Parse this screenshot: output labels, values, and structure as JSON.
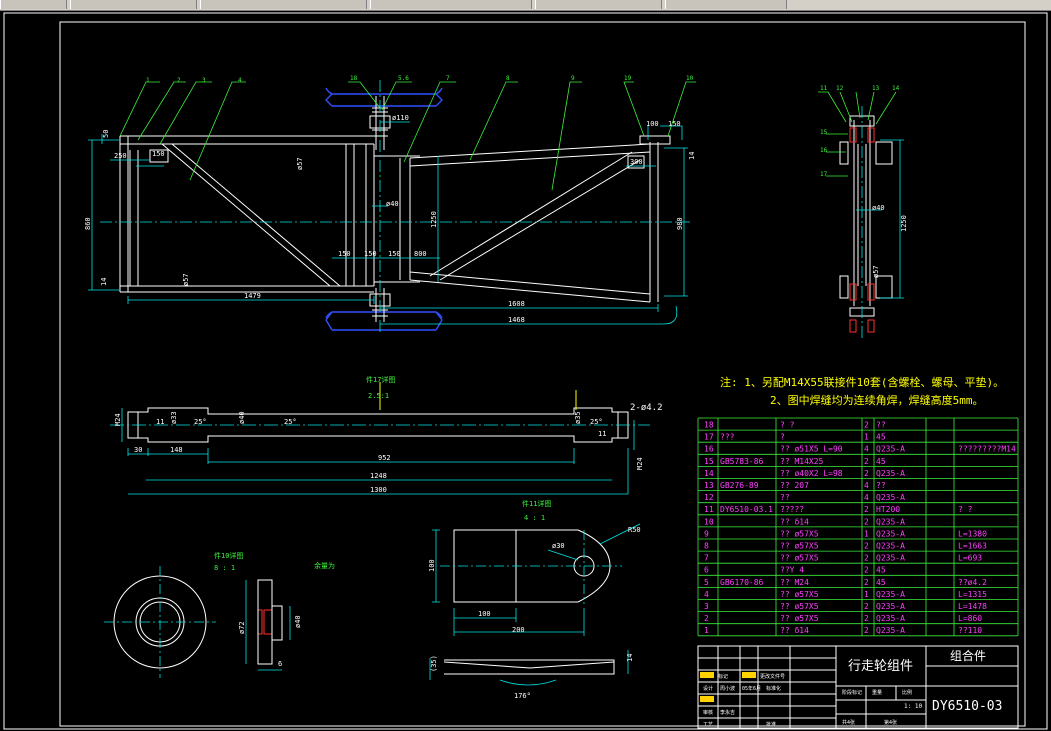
{
  "part_numbers_top": [
    "1",
    "2",
    "3",
    "4",
    "18",
    "5.6",
    "7",
    "8",
    "9",
    "19",
    "10"
  ],
  "part_numbers_side": [
    "11",
    "12",
    "13",
    "14",
    "15",
    "16",
    "17"
  ],
  "dims_top": {
    "d50": "50",
    "d250": "250",
    "d150": "150",
    "d57": "ø57",
    "d110": "ø110",
    "d100": "100",
    "d14": "14",
    "d860": "860",
    "d1250": "1250",
    "d40": "ø40",
    "d150b": "150",
    "d150c": "150",
    "d150d": "150",
    "d800": "800",
    "d980": "980",
    "d14b": "14",
    "d57b": "ø57",
    "d1479": "1479",
    "d1608": "1608",
    "d1468": "1468",
    "d300": "300"
  },
  "dims_side": {
    "d40": "ø40",
    "d1250": "1250",
    "d57": "ø57"
  },
  "detail17": {
    "title": "件17详图",
    "scale": "2.5:1",
    "dims": [
      "M24",
      "11",
      "ø33",
      "25°",
      "ø40",
      "25°",
      "ø35",
      "25°",
      "11",
      "M24",
      "30",
      "148",
      "952",
      "1248",
      "1300"
    ],
    "note": "2-ø4.2"
  },
  "detail11": {
    "title": "件11详图",
    "scale": "4 : 1",
    "dims": [
      "ø30",
      "R50",
      "100",
      "100",
      "200",
      "(35)",
      "176°",
      "14"
    ]
  },
  "detail10": {
    "title": "件10详图",
    "scale": "8 : 1",
    "side": "余量为",
    "dims": [
      "ø72",
      "ø40",
      "6"
    ]
  },
  "notes": [
    "注: 1、另配M14X55联接件10套(含螺栓、螺母、平垫)。",
    "2、图中焊缝均为连续角焊，焊缝高度5mm。"
  ],
  "bom": [
    {
      "no": "18",
      "code": "",
      "name": "? ?",
      "qty": "2",
      "mat": "??",
      "rem": ""
    },
    {
      "no": "17",
      "code": "???",
      "name": "?",
      "qty": "1",
      "mat": "45",
      "rem": ""
    },
    {
      "no": "16",
      "code": "",
      "name": "?? ø51X5    L=90",
      "qty": "4",
      "mat": "Q235-A",
      "rem": "?????????M14"
    },
    {
      "no": "15",
      "code": "GB5783-86",
      "name": "?? M14X25",
      "qty": "2",
      "mat": "45",
      "rem": ""
    },
    {
      "no": "14",
      "code": "",
      "name": "?? ø40X2    L=98",
      "qty": "2",
      "mat": "Q235-A",
      "rem": ""
    },
    {
      "no": "13",
      "code": "GB276-89",
      "name": "?? 207",
      "qty": "4",
      "mat": "??",
      "rem": ""
    },
    {
      "no": "12",
      "code": "",
      "name": "??",
      "qty": "4",
      "mat": "Q235-A",
      "rem": ""
    },
    {
      "no": "11",
      "code": "DY6510-03.1",
      "name": "?????",
      "qty": "2",
      "mat": "HT200",
      "rem": "? ?"
    },
    {
      "no": "10",
      "code": "",
      "name": "?? δ14",
      "qty": "2",
      "mat": "Q235-A",
      "rem": ""
    },
    {
      "no": "9",
      "code": "",
      "name": "?? ø57X5",
      "qty": "1",
      "mat": "Q235-A",
      "rem": "L=1380"
    },
    {
      "no": "8",
      "code": "",
      "name": "?? ø57X5",
      "qty": "2",
      "mat": "Q235-A",
      "rem": "L=1663"
    },
    {
      "no": "7",
      "code": "",
      "name": "?? ø57X5",
      "qty": "2",
      "mat": "Q235-A",
      "rem": "L=693"
    },
    {
      "no": "6",
      "code": "",
      "name": "??Y 4",
      "qty": "2",
      "mat": "45",
      "rem": ""
    },
    {
      "no": "5",
      "code": "GB6170-86",
      "name": "?? M24",
      "qty": "2",
      "mat": "45",
      "rem": "??ø4.2"
    },
    {
      "no": "4",
      "code": "",
      "name": "?? ø57X5",
      "qty": "1",
      "mat": "Q235-A",
      "rem": "L=1315"
    },
    {
      "no": "3",
      "code": "",
      "name": "?? ø57X5",
      "qty": "2",
      "mat": "Q235-A",
      "rem": "L=1478"
    },
    {
      "no": "2",
      "code": "",
      "name": "?? ø57X5",
      "qty": "2",
      "mat": "Q235-A",
      "rem": "L=860"
    },
    {
      "no": "1",
      "code": "",
      "name": "?? δ14",
      "qty": "2",
      "mat": "Q235-A",
      "rem": "??110"
    }
  ],
  "title_block": {
    "name": "行走轮组件",
    "type": "组合件",
    "drawing_no": "DY6510-03",
    "scale_val": "1: 10",
    "labels": [
      "标记",
      "处数",
      "更改文件号",
      "设计",
      "周小波",
      "05年6月",
      "标准化",
      "审核",
      "李永吉",
      "工艺",
      "批准",
      "阶段标记",
      "重量",
      "比例",
      "共4张",
      "第4张"
    ]
  },
  "colors": {
    "bg": "#000000",
    "frame": "#ffffff",
    "dim": "#00e5e5",
    "leader": "#3cf03c",
    "hatch": "#ff3030",
    "bom_text": "#ff40ff",
    "note": "#ffff00",
    "wheel": "#3050ff"
  }
}
